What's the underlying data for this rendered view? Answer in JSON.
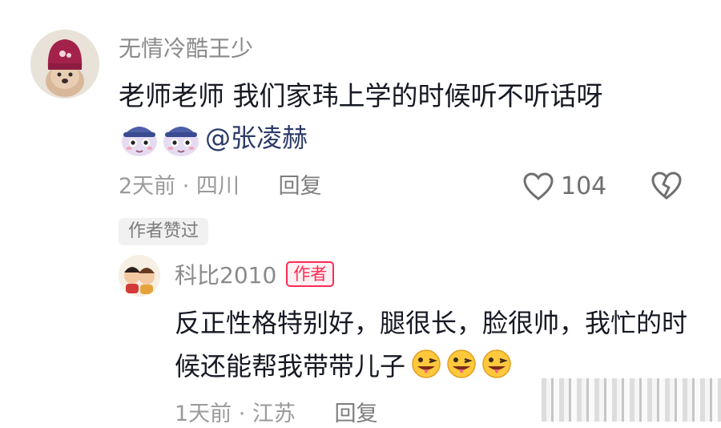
{
  "comment": {
    "username": "无情冷酷王少",
    "text": "老师老师 我们家玮上学的时候听不听话呀",
    "mention": "@张凌赫",
    "meta": "2天前 · 四川",
    "reply_label": "回复",
    "like_count": "104",
    "liked_badge": "作者赞过"
  },
  "reply": {
    "username": "科比2010",
    "author_tag": "作者",
    "text": "反正性格特别好，腿很长，脸很帅，我忙的时候还能帮我带带儿子",
    "meta": "1天前 · 江苏",
    "reply_label": "回复"
  },
  "colors": {
    "accent": "#fe2c55",
    "mention": "#2b3a67",
    "muted": "#9a9a9a"
  },
  "icons": [
    "heart-outline-icon",
    "broken-heart-icon",
    "bunny-sticker-icon",
    "tongue-wink-emoji-icon"
  ]
}
